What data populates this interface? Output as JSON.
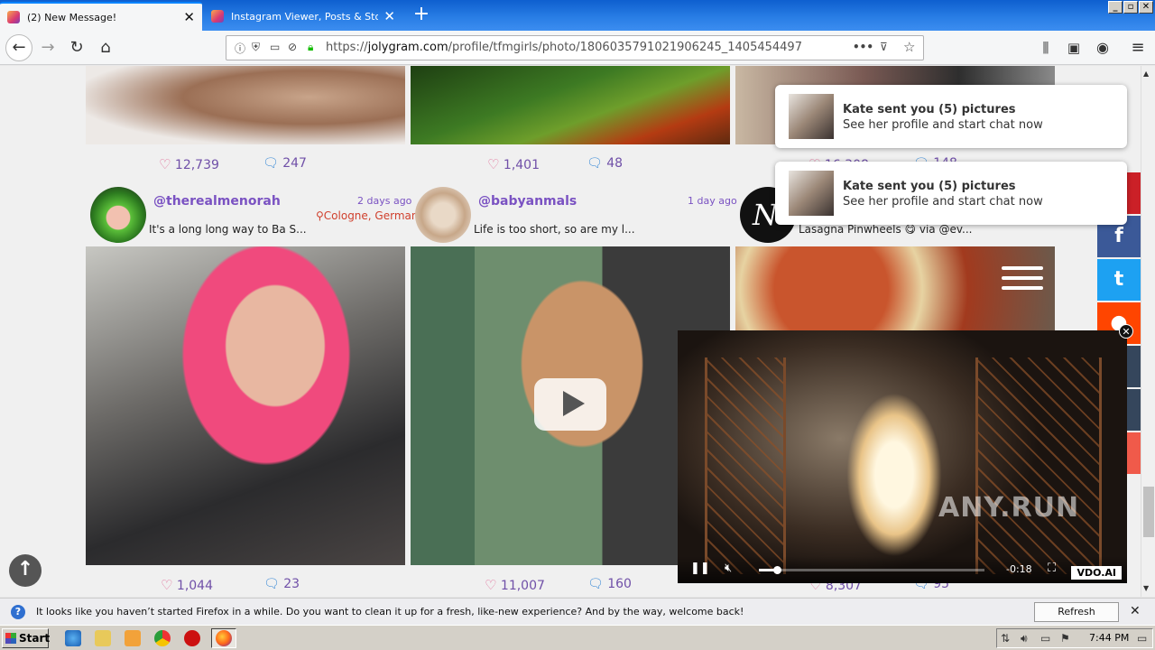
{
  "tabs": [
    {
      "title": "(2) New Message!"
    },
    {
      "title": "Instagram Viewer, Posts & Story"
    }
  ],
  "window_controls": {
    "minimize": "_",
    "restore": "▫",
    "close": "✕"
  },
  "navbar": {
    "url_prefix": "https://",
    "url_host": "jolygram.com",
    "url_path": "/profile/tfmgirls/photo/1806035791021906245_1405454497",
    "more": "•••"
  },
  "posts_row1": [
    {
      "likes": "12,739",
      "comments": "247"
    },
    {
      "likes": "1,401",
      "comments": "48"
    },
    {
      "likes": "16,308",
      "comments": "148"
    }
  ],
  "posts_row2": [
    {
      "username": "@therealmenorah",
      "ago": "2 days ago",
      "location": "Cologne, German",
      "caption": "It's a long long way to Ba S...",
      "likes": "1,044",
      "comments": "23"
    },
    {
      "username": "@babyanmals",
      "ago": "1 day ago",
      "caption": "Life is too short, so are my l...",
      "likes": "11,007",
      "comments": "160"
    },
    {
      "caption": "Lasagna Pinwheels 😋 via @ev...",
      "avatar_letter": "N",
      "likes": "8,307",
      "comments": "95"
    }
  ],
  "notifications": [
    {
      "title": "Kate sent you (5) pictures",
      "body": "See her profile and start chat now"
    },
    {
      "title": "Kate sent you (5) pictures",
      "body": "See her profile and start chat now"
    }
  ],
  "share": {
    "pinterest": "P",
    "facebook": "f",
    "twitter": "t",
    "colors": {
      "pinterest": "#cb2027",
      "facebook": "#3b5998",
      "twitter": "#1da1f2",
      "reddit": "#ff4500",
      "tumblr": "#35465c",
      "email": "#f05a4a"
    }
  },
  "video": {
    "time": "-0:18",
    "brand": "VDO.AI"
  },
  "watermark": "ANY.RUN",
  "infobar": {
    "message": "It looks like you haven’t started Firefox in a while. Do you want to clean it up for a fresh, like-new experience? And by the way, welcome back!",
    "button": "Refresh Firefox…"
  },
  "taskbar": {
    "start": "Start",
    "time": "7:44 PM"
  },
  "icons": [
    "instagram-favicon",
    "back-icon",
    "forward-icon",
    "reload-icon",
    "home-icon",
    "info-icon",
    "shield-icon",
    "lock-icon",
    "bookmark-star-icon",
    "pocket-icon",
    "library-icon",
    "sidebar-icon",
    "account-icon",
    "hamburger-menu-icon",
    "heart-icon",
    "comment-icon",
    "play-icon",
    "pause-icon",
    "mute-icon",
    "fullscreen-icon",
    "scroll-top-icon",
    "help-icon"
  ]
}
